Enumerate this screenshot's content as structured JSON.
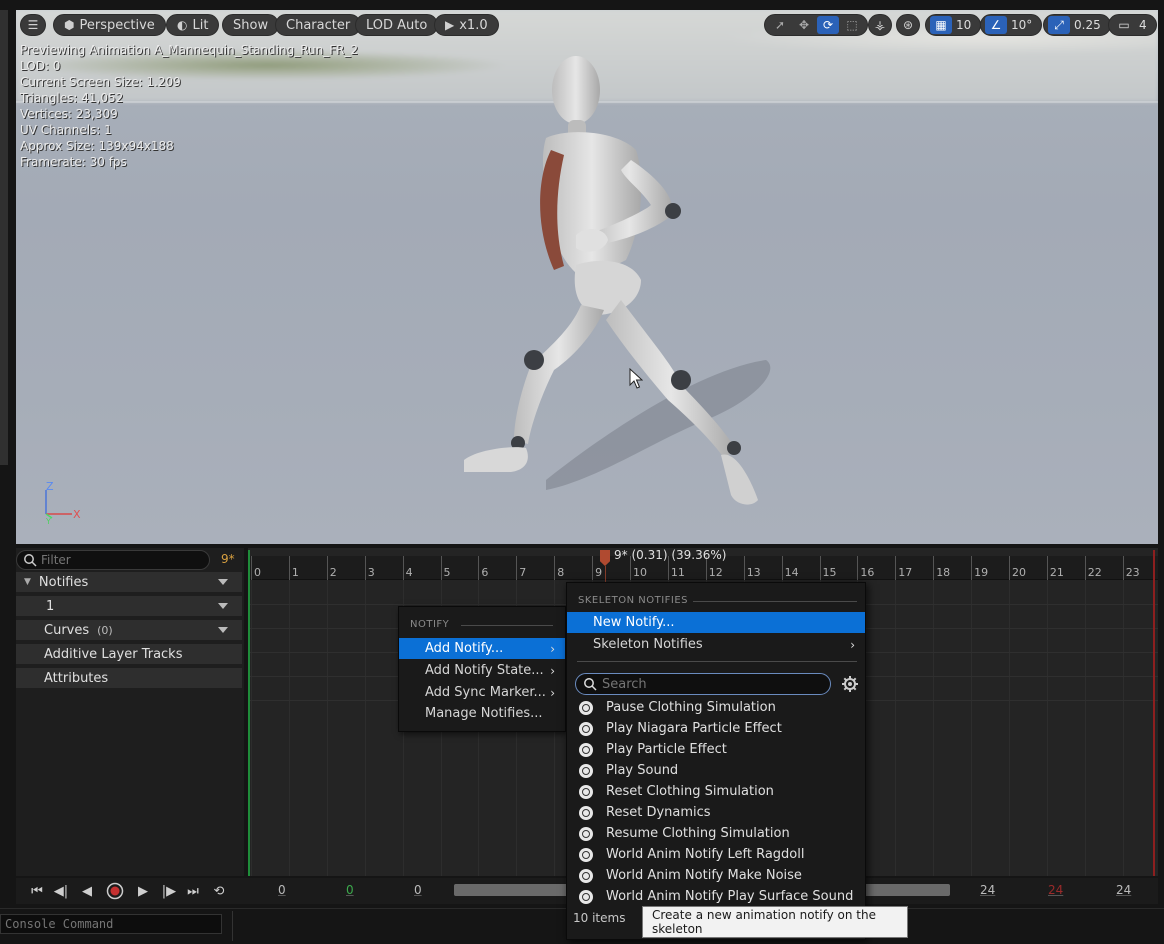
{
  "toolbar": {
    "perspective": "Perspective",
    "lit": "Lit",
    "show": "Show",
    "character": "Character",
    "lod": "LOD Auto",
    "speed": "x1.0",
    "grid_value": "10",
    "angle_value": "10°",
    "scale_value": "0.25",
    "camera_value": "4"
  },
  "stats": [
    "Previewing Animation A_Mannequin_Standing_Run_FR_2",
    "LOD: 0",
    "Current Screen Size: 1.209",
    "Triangles: 41,052",
    "Vertices: 23,309",
    "UV Channels: 1",
    "Approx Size: 139x94x188",
    "Framerate: 30 fps"
  ],
  "axes": {
    "x": "X",
    "z": "Z",
    "y": "Y"
  },
  "tracks": {
    "filter_placeholder": "Filter",
    "frame_badge": "9*",
    "notifies": "Notifies",
    "notify_track_1": "1",
    "curves": "Curves",
    "curves_count": "(0)",
    "additive": "Additive Layer Tracks",
    "attributes": "Attributes"
  },
  "timeline": {
    "playhead_label": "9* (0.31) (39.36%)",
    "ticks": [
      "0",
      "1",
      "2",
      "3",
      "4",
      "5",
      "6",
      "7",
      "8",
      "9",
      "10",
      "11",
      "12",
      "13",
      "14",
      "15",
      "16",
      "17",
      "18",
      "19",
      "20",
      "21",
      "22",
      "23"
    ]
  },
  "transport": {
    "range_start": "0",
    "range_start_green": "0",
    "range_view_start": "0",
    "range_view_end": "24",
    "range_end_red": "24",
    "range_end": "24"
  },
  "console": {
    "placeholder": "Console Command"
  },
  "menu_notify": {
    "header": "NOTIFY",
    "items": [
      "Add Notify...",
      "Add Notify State...",
      "Add Sync Marker...",
      "Manage Notifies..."
    ]
  },
  "menu_skeleton": {
    "header": "SKELETON NOTIFIES",
    "new_notify": "New Notify...",
    "skeleton_notifies": "Skeleton Notifies",
    "search_placeholder": "Search",
    "notifies": [
      "Pause Clothing Simulation",
      "Play Niagara Particle Effect",
      "Play Particle Effect",
      "Play Sound",
      "Reset Clothing Simulation",
      "Reset Dynamics",
      "Resume Clothing Simulation",
      "World Anim Notify Left Ragdoll",
      "World Anim Notify Make Noise",
      "World Anim Notify Play Surface Sound"
    ],
    "count": "10 items"
  },
  "tooltip": "Create a new animation notify on the skeleton",
  "colors": {
    "accent": "#0b70d6",
    "playhead": "#b04a30",
    "start": "#1f8d3a",
    "end": "#8d1f1f"
  }
}
